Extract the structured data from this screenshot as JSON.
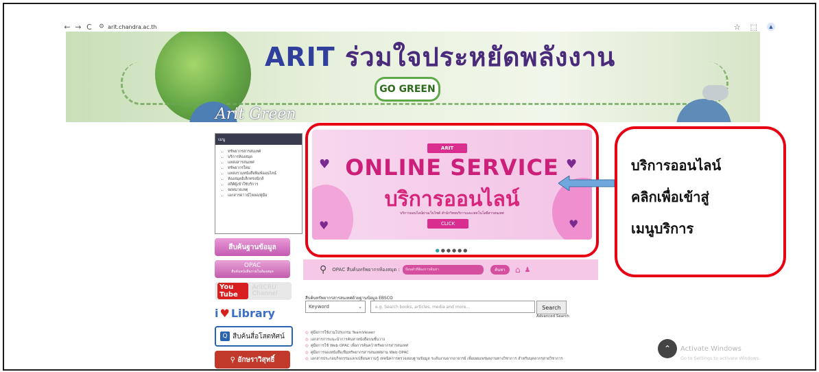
{
  "browser": {
    "back": "←",
    "forward": "→",
    "reload": "C",
    "url": "arit.chandra.ac.th",
    "star": "☆",
    "extensions": "⬚",
    "profile": "▲"
  },
  "hero": {
    "title_arit": "ARIT",
    "title_thai": "ร่วมใจประหยัดพลังงาน",
    "go_green": "GO GREEN",
    "subtitle": "Arit Green"
  },
  "sidebar": {
    "menu_title": "เมนู",
    "items": [
      "ทรัพยากรสารสนเทศ",
      "บริการห้องสมุด",
      "แหล่งสารสนเทศ",
      "ทรัพยากรใหม่",
      "แหล่งรวมหนังสือพิมพ์ออนไลน์",
      "ห้องสมุดอิเล็กทรอนิกส์",
      "สถิติผู้เข้าใช้บริการ",
      "จดหมายเหตุ",
      "เอกสารดาวน์โหลด/คู่มือ"
    ],
    "search_db": "สืบค้นฐานข้อมูล",
    "opac": "OPAC",
    "opac_sub": "สืบค้นหนังสือภายในห้องสมุด",
    "youtube": "You Tube",
    "youtube_text": "AritCRU Channel",
    "library": "Library",
    "media": "สืบค้นสื่อโสตทัศน์",
    "alpha": "อักษราวิสุทธิ์"
  },
  "slide": {
    "arit_tag": "ARIT",
    "online_service": "ONLINE SERVICE",
    "thai_service": "บริการออนไลน์",
    "small_text": "บริการออนไลน์ผ่านเว็บไซต์ สำนักวิทยบริการและเทคโนโลยีสารสนเทศ",
    "click": "CLICK",
    "dots": "●●●●●●"
  },
  "callout": {
    "line1": "บริการออนไลน์",
    "line2": "คลิกเพื่อเข้าสู่",
    "line3": "เมนูบริการ"
  },
  "opac_strip": {
    "label": "OPAC",
    "label2": "สืบค้นทรัพยากรห้องสมุด :",
    "placeholder": "ป้อนคำที่ต้องการค้นหา",
    "button": "ค้นหา"
  },
  "ebsco": {
    "label": "สืบค้นทรัพยากรสารสนเทศด้วยฐานข้อมูล EBSCO",
    "select_value": "Keyword",
    "placeholder": "e.g. Search books, articles, media and more...",
    "search": "Search",
    "advanced": "Advanced Search"
  },
  "links": [
    "คู่มือการใช้งานโปรแกรม TeamViewer",
    "เอกสารการแนะนำการค้นหาหนังสือบนชั้นวาง",
    "คู่มือการใช้ Web OPAC เพื่อการค้นคว้าทรัพยากรสารสนเทศ",
    "คู่มือการจองหนังสือ/ยืมทรัพยากรสารสนเทศผ่าน Web OPAC",
    "เอกสารประกอบกิจกรรมแลกเปลี่ยนความรู้ เทคนิคการตรวจสอบฐานข้อมูล ระดับงานจากอาจารย์ เพื่อเผยแพร่ผลงานทางวิชาการ สำหรับบุคลากรสายวิชาการ"
  ],
  "watermark": {
    "line1": "Activate Windows",
    "line2": "Go to Settings to activate Windows."
  }
}
